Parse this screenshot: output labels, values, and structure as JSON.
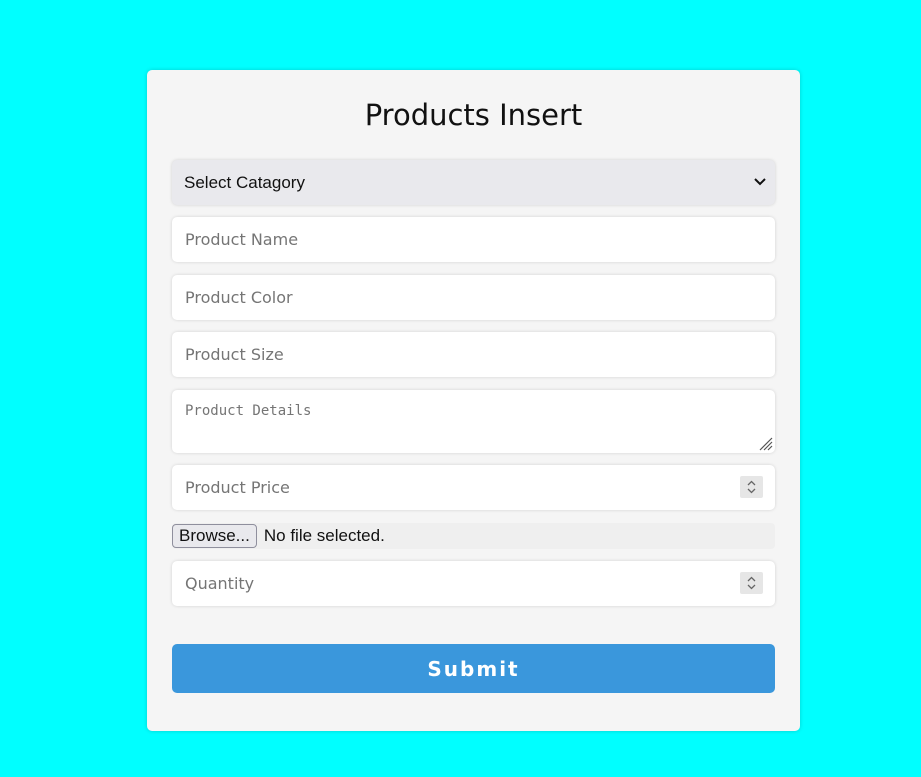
{
  "form": {
    "title": "Products Insert",
    "category": {
      "selected": "Select Catagory"
    },
    "product_name": {
      "placeholder": "Product Name"
    },
    "product_color": {
      "placeholder": "Product Color"
    },
    "product_size": {
      "placeholder": "Product Size"
    },
    "product_details": {
      "placeholder": "Product Details"
    },
    "product_price": {
      "placeholder": "Product Price"
    },
    "file": {
      "button_label": "Browse...",
      "status": "No file selected."
    },
    "quantity": {
      "placeholder": "Quantity"
    },
    "submit_label": "Submit"
  },
  "colors": {
    "background": "#00ffff",
    "card": "#f5f5f5",
    "submit": "#3a97dc"
  },
  "icons": {
    "select_arrow": "chevron-down-icon",
    "resize": "resize-grip-icon",
    "number": "spinner-icon"
  }
}
